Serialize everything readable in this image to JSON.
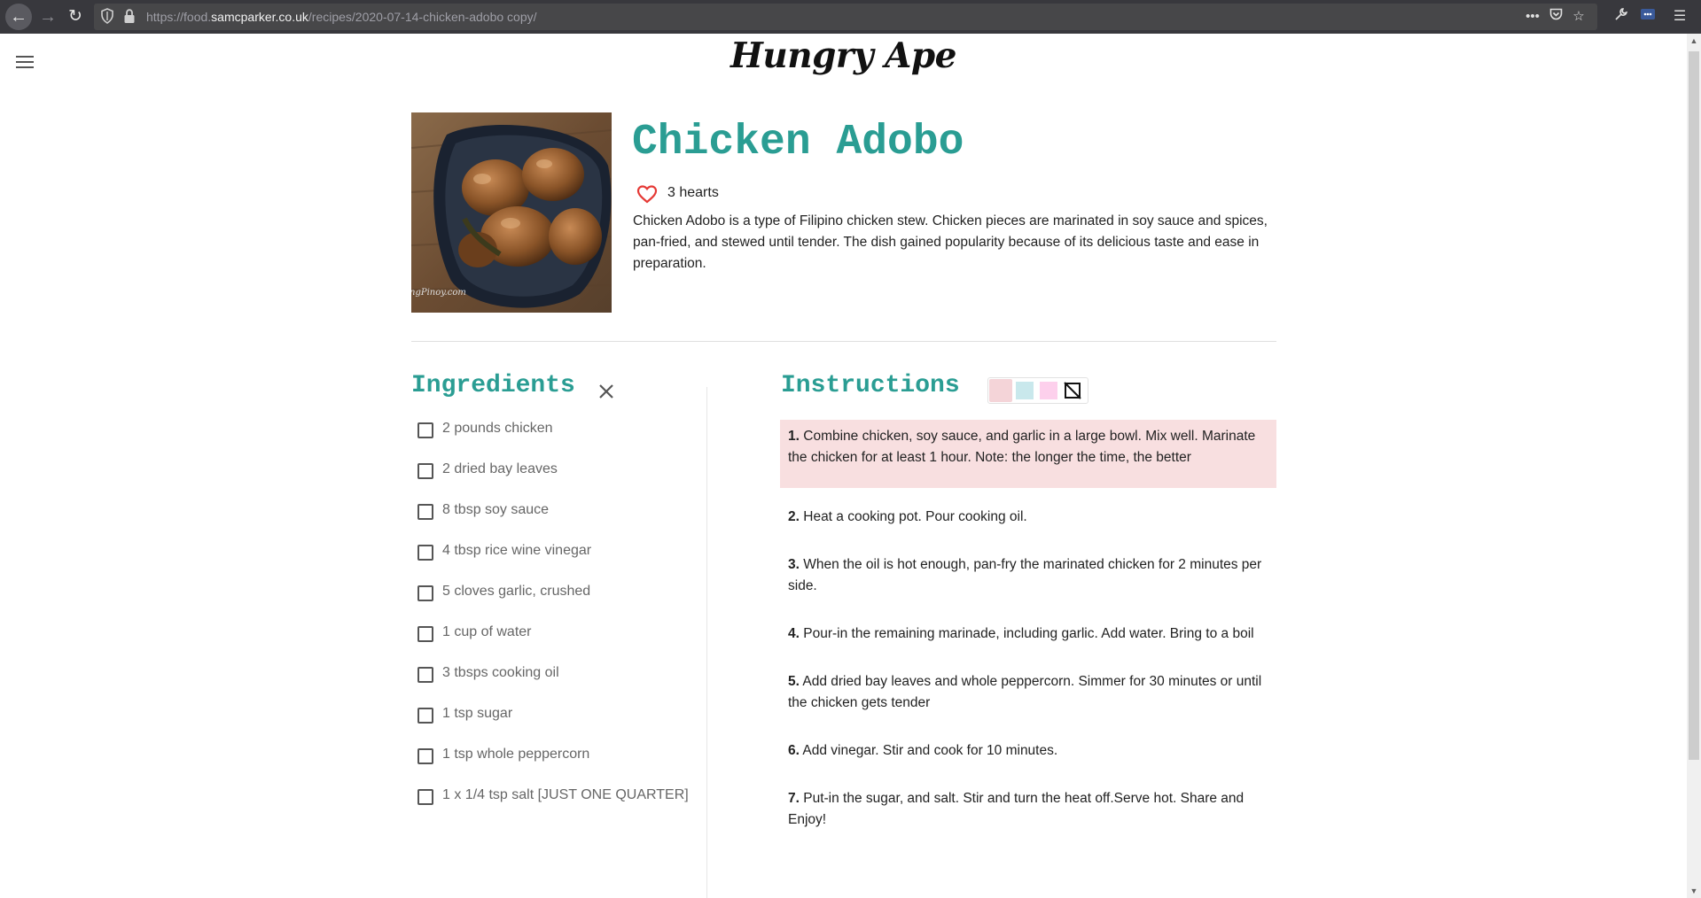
{
  "browser": {
    "url_prefix": "https://food.",
    "url_host": "samcparker.co.uk",
    "url_path": "/recipes/2020-07-14-chicken-adobo copy/"
  },
  "site": {
    "title": "Hungry Ape"
  },
  "recipe": {
    "title": "Chicken Adobo",
    "hearts_label": "3 hearts",
    "description": "Chicken Adobo is a type of Filipino chicken stew. Chicken pieces are marinated in soy sauce and spices, pan-fried, and stewed until tender. The dish gained popularity because of its delicious taste and ease in preparation.",
    "photo_watermark": "ngPinoy.com"
  },
  "ingredients": {
    "heading": "Ingredients",
    "items": [
      {
        "label": "2 pounds chicken",
        "checked": false
      },
      {
        "label": "2 dried bay leaves",
        "checked": false
      },
      {
        "label": "8 tbsp soy sauce",
        "checked": false
      },
      {
        "label": "4 tbsp rice wine vinegar",
        "checked": false
      },
      {
        "label": "5 cloves garlic, crushed",
        "checked": false
      },
      {
        "label": "1 cup of water",
        "checked": false
      },
      {
        "label": "3 tbsps cooking oil",
        "checked": false
      },
      {
        "label": "1 tsp sugar",
        "checked": false
      },
      {
        "label": "1 tsp whole peppercorn",
        "checked": false
      },
      {
        "label": "1 x 1/4 tsp salt [JUST ONE QUARTER]",
        "checked": false
      }
    ]
  },
  "instructions": {
    "heading": "Instructions",
    "highlight_colors": [
      "#f4d4d8",
      "#c9e8ec",
      "#fdd0ec"
    ],
    "steps": [
      {
        "num": "1.",
        "text": "Combine chicken, soy sauce, and garlic in a large bowl. Mix well. Marinate the chicken for at least 1 hour. Note: the longer the time, the better"
      },
      {
        "num": "2.",
        "text": "Heat a cooking pot. Pour cooking oil."
      },
      {
        "num": "3.",
        "text": "When the oil is hot enough, pan-fry the marinated chicken for 2 minutes per side."
      },
      {
        "num": "4.",
        "text": "Pour-in the remaining marinade, including garlic. Add water. Bring to a boil"
      },
      {
        "num": "5.",
        "text": "Add dried bay leaves and whole peppercorn. Simmer for 30 minutes or until the chicken gets tender"
      },
      {
        "num": "6.",
        "text": "Add vinegar. Stir and cook for 10 minutes."
      },
      {
        "num": "7.",
        "text": "Put-in the sugar, and salt. Stir and turn the heat off.Serve hot. Share and Enjoy!"
      }
    ]
  }
}
